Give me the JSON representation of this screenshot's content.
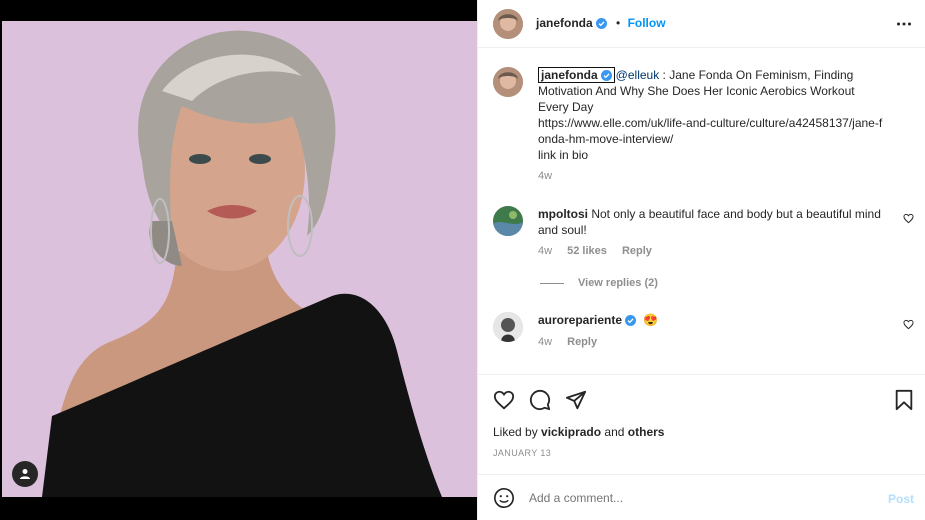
{
  "post": {
    "author": "janefonda",
    "follow_label": "Follow",
    "separator": "•"
  },
  "caption": {
    "author": "janefonda",
    "mention": "@elleuk",
    "text": " : Jane Fonda On Feminism, Finding Motivation And Why She Does Her Iconic Aerobics Workout Every Day",
    "link": "https://www.elle.com/uk/life-and-culture/culture/a42458137/jane-fonda-hm-move-interview/",
    "link_in_bio": "link in bio",
    "time": "4w"
  },
  "comments": [
    {
      "user": "mpoltosi",
      "text": "Not only a beautiful face and body but a beautiful mind and soul!",
      "time": "4w",
      "likes": "52 likes",
      "reply": "Reply",
      "view_replies": "View replies (2)"
    },
    {
      "user": "aurorepariente",
      "text": "😍",
      "time": "4w",
      "reply": "Reply"
    }
  ],
  "engagement": {
    "liked_by_prefix": "Liked by",
    "liked_by_user": "vickiprado",
    "and": "and",
    "others": "others",
    "date": "JANUARY 13"
  },
  "comment_box": {
    "placeholder": "Add a comment...",
    "post_label": "Post"
  },
  "icons": {
    "verified": "verified-badge-icon",
    "more": "more-options-icon",
    "like": "heart-icon",
    "comment": "comment-bubble-icon",
    "share": "paper-plane-icon",
    "save": "bookmark-icon",
    "emoji": "emoji-icon",
    "tag": "user-tag-icon"
  },
  "colors": {
    "link_blue": "#0095f6",
    "muted": "#8e8e8e",
    "verified_blue": "#3897f0",
    "photo_background": "#dcc1dc"
  }
}
